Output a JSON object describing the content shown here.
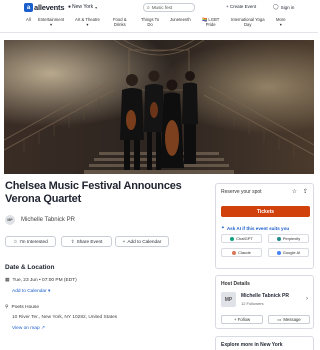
{
  "header": {
    "logo_mark": "a",
    "logo_text": "allevents",
    "location": "New York",
    "search_placeholder": "Music fest",
    "create_event": "+ Create Event",
    "sign_in": "Sign in"
  },
  "categories": [
    {
      "line1": "All",
      "line2": ""
    },
    {
      "line1": "Entertainment",
      "line2": "▾"
    },
    {
      "line1": "Art & Theatre",
      "line2": "▾"
    },
    {
      "line1": "Food &",
      "line2": "Drinks"
    },
    {
      "line1": "Things To",
      "line2": "Do"
    },
    {
      "line1": "Juneteenth",
      "line2": ""
    },
    {
      "line1": "🏳️‍🌈 LGBT",
      "line2": "Pride"
    },
    {
      "line1": "International Yoga",
      "line2": "Day"
    },
    {
      "line1": "More",
      "line2": "▾"
    }
  ],
  "event": {
    "title": "Chelsea Music Festival Announces Verona Quartet",
    "organizer_initials": "MP",
    "organizer": "Michelle Tabnick PR"
  },
  "actions": {
    "interested": "I'm Interested",
    "share": "Share Event",
    "add_calendar": "Add to Calendar"
  },
  "date_location": {
    "heading": "Date & Location",
    "datetime": "Tue, 23 Jun • 07:00 PM (EDT)",
    "add_to_calendar": "Add to Calendar ▾",
    "venue": "Poets House",
    "address": "10 River Ter., New York, NY 10282, United States",
    "map_link": "View on map ↗"
  },
  "reserve": {
    "heading": "Reserve your spot",
    "tickets": "Tickets",
    "ai_prompt": "Ask AI if this event suits you",
    "ai_options": [
      "ChatGPT",
      "Perplexity",
      "Claude",
      "Google AI"
    ]
  },
  "host": {
    "heading": "Host Details",
    "initials": "MP",
    "name": "Michelle Tabnick PR",
    "followers": "12 Followers",
    "follow": "+ Follow",
    "message": "Message"
  },
  "explore": {
    "heading": "Explore more in New York"
  },
  "colors": {
    "accent_blue": "#1a5ecc",
    "ticket_orange": "#d1410c"
  }
}
